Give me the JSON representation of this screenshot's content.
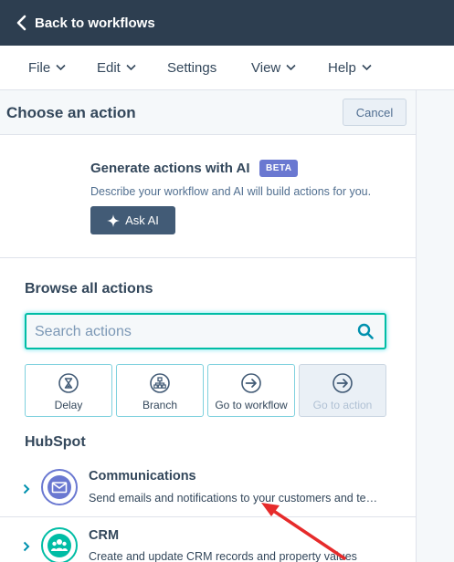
{
  "topbar": {
    "back_label": "Back to workflows"
  },
  "menu": {
    "items": [
      {
        "label": "File"
      },
      {
        "label": "Edit"
      },
      {
        "label": "Settings"
      },
      {
        "label": "View"
      },
      {
        "label": "Help"
      }
    ]
  },
  "panel": {
    "title": "Choose an action",
    "cancel_label": "Cancel",
    "ai": {
      "title": "Generate actions with AI",
      "badge": "BETA",
      "description": "Describe your workflow and AI will build actions for you.",
      "button_label": "Ask AI"
    },
    "browse": {
      "title": "Browse all actions",
      "search_placeholder": "Search actions",
      "tiles": [
        {
          "label": "Delay",
          "icon": "hourglass-icon"
        },
        {
          "label": "Branch",
          "icon": "branch-icon"
        },
        {
          "label": "Go to workflow",
          "icon": "arrow-circle-icon"
        },
        {
          "label": "Go to action",
          "icon": "arrow-circle-icon",
          "disabled": true
        }
      ]
    },
    "hubspot": {
      "title": "HubSpot",
      "categories": [
        {
          "name": "Communications",
          "description": "Send emails and notifications to your customers and te…",
          "icon": "envelope-icon",
          "color": "#6a78d1"
        },
        {
          "name": "CRM",
          "description": "Create and update CRM records and property values",
          "icon": "people-icon",
          "color": "#00bda5"
        }
      ]
    }
  },
  "colors": {
    "topbar": "#2d3e50",
    "accent_teal": "#00bda5",
    "annotation_arrow": "#e62b2b"
  }
}
